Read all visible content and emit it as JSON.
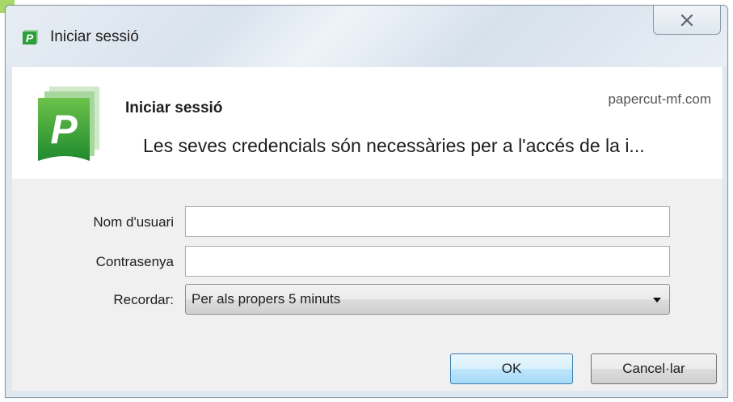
{
  "window": {
    "title": "Iniciar sessió",
    "close_icon": "close-icon"
  },
  "header": {
    "title": "Iniciar sessió",
    "domain": "papercut-mf.com",
    "message": "Les seves credencials són necessàries per a l'accés de la i...",
    "logo_icon": "papercut-logo-icon"
  },
  "form": {
    "username": {
      "label": "Nom d'usuari",
      "value": "",
      "placeholder": ""
    },
    "password": {
      "label": "Contrasenya",
      "value": "",
      "placeholder": ""
    },
    "remember": {
      "label": "Recordar:",
      "selected": "Per als propers 5 minuts"
    }
  },
  "buttons": {
    "ok_label": "OK",
    "cancel_label": "Cancel·lar"
  },
  "colors": {
    "brand_green": "#2e9e3a",
    "ok_border": "#3c7fb1"
  }
}
